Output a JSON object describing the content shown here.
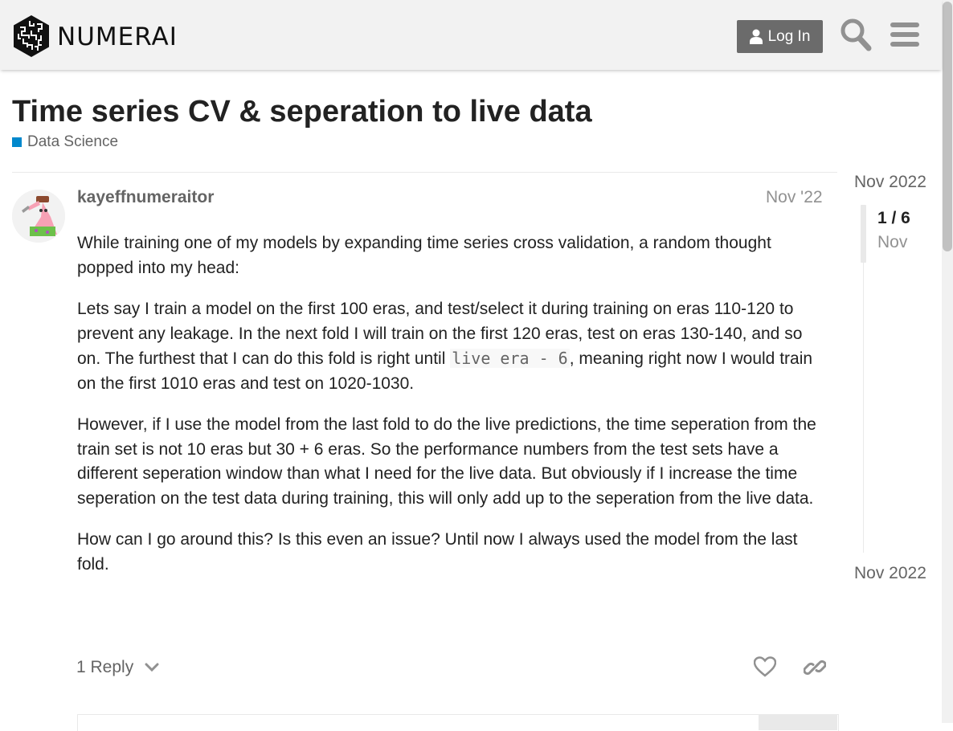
{
  "header": {
    "logo_text": "NUMERAI",
    "login_label": "Log In"
  },
  "topic": {
    "title": "Time series CV & seperation to live data",
    "category": {
      "label": "Data Science",
      "color": "#0088cc"
    }
  },
  "post": {
    "username": "kayeffnumeraitor",
    "date": "Nov '22",
    "paragraphs": {
      "p1": "While training one of my models by expanding time series cross validation, a random thought popped into my head:",
      "p2_before": "Lets say I train a model on the first 100 eras, and test/select it during training on eras 110-120 to prevent any leakage. In the next fold I will train on the first 120 eras, test on eras 130-140, and so on. The furthest that I can do this fold is right until ",
      "p2_code": "live era - 6",
      "p2_after": ", meaning right now I would train on the first 1010 eras and test on 1020-1030.",
      "p3": "However, if I use the model from the last fold to do the live predictions, the time seperation from the train set is not 10 eras but 30 + 6 eras. So the performance numbers from the test sets have a different seperation window than what I need for the live data. But obviously if I increase the time seperation on the test data during training, this will only add up to the seperation from the live data.",
      "p4": "How can I go around this? Is this even an issue? Until now I always used the model from the last fold."
    },
    "replies_label": "1 Reply"
  },
  "timeline": {
    "start_date": "Nov 2022",
    "position": "1 / 6",
    "current_date": "Nov",
    "end_date": "Nov 2022"
  },
  "icons": {
    "logo": "numerai-logo-icon",
    "user": "user-icon",
    "search": "search-icon",
    "menu": "hamburger-menu-icon",
    "chevron": "chevron-down-icon",
    "like": "heart-icon",
    "link": "link-icon"
  }
}
